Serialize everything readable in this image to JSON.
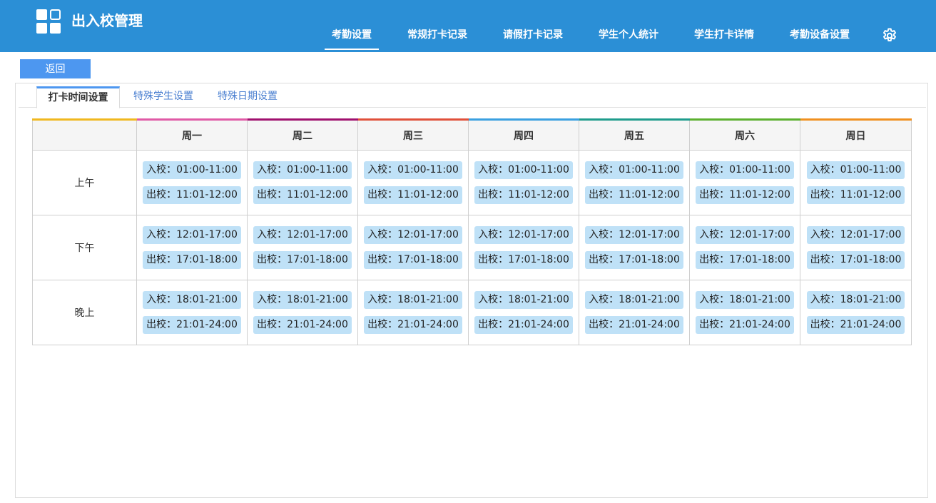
{
  "header": {
    "app_title": "出入校管理",
    "nav": [
      {
        "label": "考勤设置",
        "active": true
      },
      {
        "label": "常规打卡记录",
        "active": false
      },
      {
        "label": "请假打卡记录",
        "active": false
      },
      {
        "label": "学生个人统计",
        "active": false
      },
      {
        "label": "学生打卡详情",
        "active": false
      },
      {
        "label": "考勤设备设置",
        "active": false
      }
    ],
    "settings_icon": "gear-icon"
  },
  "back_label": "返回",
  "tabs": [
    {
      "label": "打卡时间设置",
      "active": true
    },
    {
      "label": "特殊学生设置",
      "active": false
    },
    {
      "label": "特殊日期设置",
      "active": false
    }
  ],
  "table": {
    "days": [
      {
        "label": "周一",
        "color": "#e05aa6"
      },
      {
        "label": "周二",
        "color": "#a0106e"
      },
      {
        "label": "周三",
        "color": "#e0503a"
      },
      {
        "label": "周四",
        "color": "#3aa0e0"
      },
      {
        "label": "周五",
        "color": "#1f9c8c"
      },
      {
        "label": "周六",
        "color": "#5cb030"
      },
      {
        "label": "周日",
        "color": "#f09020"
      }
    ],
    "corner_color": "#f0b820",
    "periods": [
      {
        "label": "上午",
        "in": "入校：01:00-11:00",
        "out": "出校：11:01-12:00"
      },
      {
        "label": "下午",
        "in": "入校：12:01-17:00",
        "out": "出校：17:01-18:00"
      },
      {
        "label": "晚上",
        "in": "入校：18:01-21:00",
        "out": "出校：21:01-24:00"
      }
    ]
  }
}
